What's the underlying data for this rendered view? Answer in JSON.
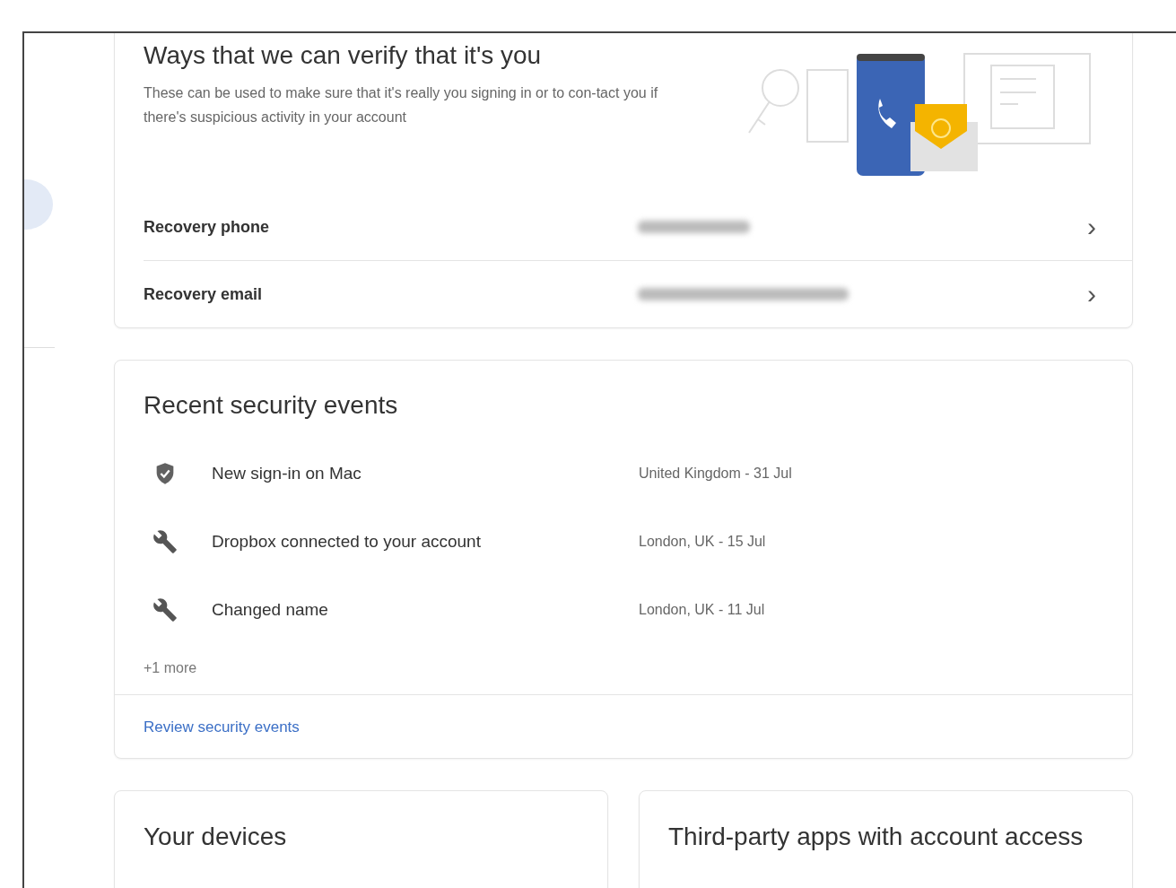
{
  "verify_card": {
    "title": "Ways that we can verify that it's you",
    "description": "These can be used to make sure that it's really you signing in or to con-tact you if there's suspicious activity in your account",
    "rows": [
      {
        "label": "Recovery phone",
        "chevron": "›"
      },
      {
        "label": "Recovery email",
        "chevron": "›"
      }
    ]
  },
  "security_card": {
    "title": "Recent security events",
    "events": [
      {
        "kind": "shield",
        "title": "New sign-in on Mac",
        "detail": "United Kingdom - 31 Jul"
      },
      {
        "kind": "wrench",
        "title": "Dropbox connected to your account",
        "detail": "London, UK - 15 Jul"
      },
      {
        "kind": "wrench",
        "title": "Changed name",
        "detail": "London, UK - 11 Jul"
      }
    ],
    "more": "+1 more",
    "link": "Review security events"
  },
  "bottom_cards": [
    {
      "title": "Your devices"
    },
    {
      "title": "Third-party apps with account access"
    }
  ]
}
